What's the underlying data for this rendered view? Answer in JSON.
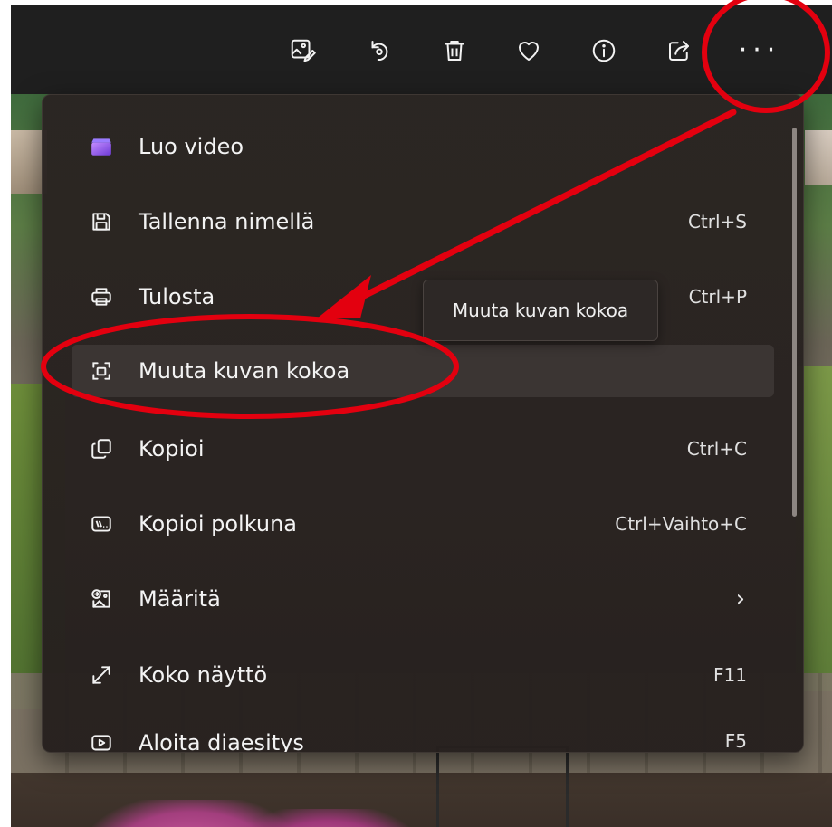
{
  "toolbar": {
    "buttons": [
      {
        "icon": "edit-image-icon"
      },
      {
        "icon": "rotate-icon"
      },
      {
        "icon": "delete-icon"
      },
      {
        "icon": "favorite-heart-icon"
      },
      {
        "icon": "info-icon"
      },
      {
        "icon": "share-icon"
      }
    ],
    "more_label": "···"
  },
  "menu": {
    "items": [
      {
        "label": "Luo video",
        "shortcut": "",
        "icon": "video-editor-icon"
      },
      {
        "label": "Tallenna nimellä",
        "shortcut": "Ctrl+S",
        "icon": "save-icon"
      },
      {
        "label": "Tulosta",
        "shortcut": "Ctrl+P",
        "icon": "print-icon"
      },
      {
        "label": "Muuta kuvan kokoa",
        "shortcut": "",
        "icon": "resize-image-icon"
      },
      {
        "label": "Kopioi",
        "shortcut": "Ctrl+C",
        "icon": "copy-icon"
      },
      {
        "label": "Kopioi polkuna",
        "shortcut": "Ctrl+Vaihto+C",
        "icon": "copy-path-icon"
      },
      {
        "label": "Määritä",
        "shortcut": "",
        "icon": "set-as-icon",
        "submenu_indicator": "›"
      },
      {
        "label": "Koko näyttö",
        "shortcut": "F11",
        "icon": "fullscreen-icon"
      },
      {
        "label": "Aloita diaesitys",
        "shortcut": "F5",
        "icon": "slideshow-icon"
      }
    ]
  },
  "tooltip": {
    "text": "Muuta kuvan kokoa"
  },
  "colors": {
    "annotation": "#e3000f",
    "toolbar_bg": "#1f1f1f",
    "menu_bg": "#2a2422",
    "hover_bg": "#3b3533"
  }
}
